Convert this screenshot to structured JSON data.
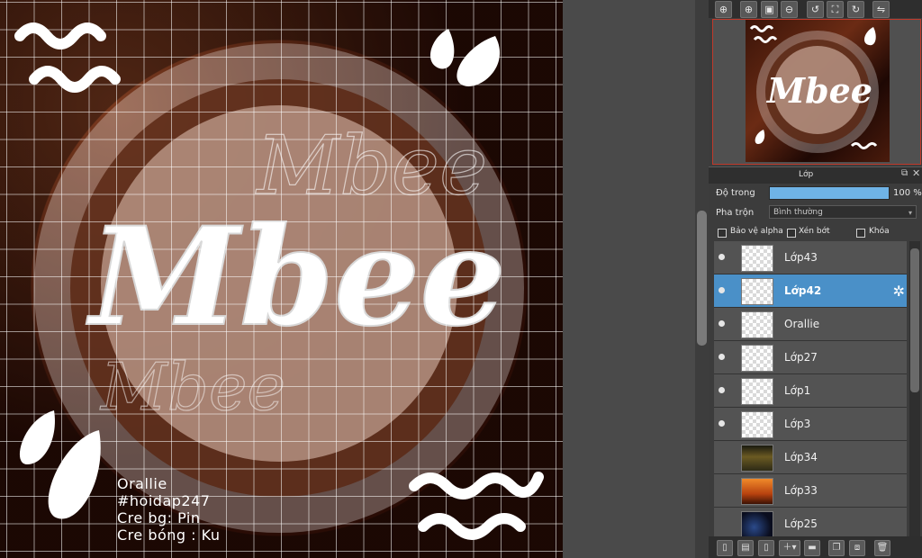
{
  "canvas": {
    "logo_text": "Mbee",
    "ghost_text_1": "Mbee",
    "ghost_text_2": "Mbee",
    "credits": [
      "Orallie",
      "#hoidap247",
      "Cre bg: Pin",
      "Cre bóng : Ku"
    ]
  },
  "navigator": {
    "toolbar_icons": [
      "zoom-in-icon",
      "zoom-in-alt-icon",
      "fit-screen-icon",
      "zoom-out-icon",
      "rotate-left-icon",
      "fullscreen-icon",
      "rotate-right-icon",
      "flip-icon"
    ],
    "preview_logo": "Mbee"
  },
  "layers_panel": {
    "title": "Lớp",
    "opacity_label": "Độ trong",
    "opacity_value": "100 %",
    "opacity_fraction": 1.0,
    "blend_label": "Pha trộn",
    "blend_value": "Bình thường",
    "protect_alpha_label": "Bảo vệ alpha",
    "clipping_label": "Xén bớt",
    "lock_label": "Khóa",
    "layers": [
      {
        "name": "Lớp43",
        "visible": true,
        "thumb": "transparent"
      },
      {
        "name": "Lớp42",
        "visible": true,
        "thumb": "transparent",
        "selected": true
      },
      {
        "name": "Orallie",
        "visible": true,
        "thumb": "transparent"
      },
      {
        "name": "Lớp27",
        "visible": true,
        "thumb": "transparent"
      },
      {
        "name": "Lớp1",
        "visible": true,
        "thumb": "transparent"
      },
      {
        "name": "Lớp3",
        "visible": true,
        "thumb": "transparent"
      },
      {
        "name": "Lớp34",
        "visible": false,
        "thumb": "photo1"
      },
      {
        "name": "Lớp33",
        "visible": false,
        "thumb": "photo2"
      },
      {
        "name": "Lớp25",
        "visible": false,
        "thumb": "photo3"
      }
    ],
    "bottom_icons": [
      "new-layer-icon",
      "new-layer-alt-icon",
      "duplicate-layer-icon",
      "add-layer-menu-icon",
      "folder-icon",
      "copy-layer-icon",
      "merge-icon",
      "delete-layer-icon"
    ]
  },
  "colors": {
    "selection": "#4a90c8",
    "opacity_fill": "#6fb3e6",
    "panel_bg": "#3c3c3c"
  }
}
